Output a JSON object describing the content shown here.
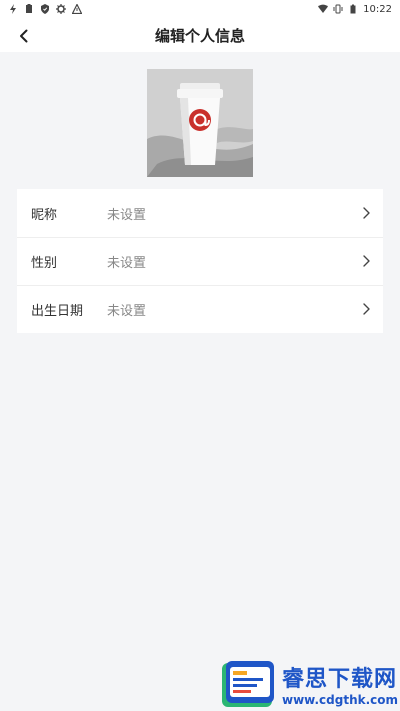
{
  "status_bar": {
    "time": "10:22",
    "left_icons": [
      "flash-icon",
      "clipboard-icon",
      "shield-icon",
      "settings-icon",
      "warning-icon"
    ],
    "right_icons": [
      "wifi-icon",
      "vibrate-icon",
      "battery-icon"
    ]
  },
  "header": {
    "title": "编辑个人信息",
    "back_icon": "back-arrow-icon"
  },
  "profile": {
    "avatar_alt": "avatar"
  },
  "fields": [
    {
      "label": "昵称",
      "value": "未设置"
    },
    {
      "label": "性别",
      "value": "未设置"
    },
    {
      "label": "出生日期",
      "value": "未设置"
    }
  ],
  "watermark": {
    "title": "睿思下载网",
    "url": "www.cdgthk.com"
  },
  "colors": {
    "background": "#f4f5f7",
    "card": "#ffffff",
    "watermark_blue": "#1f56c7"
  }
}
